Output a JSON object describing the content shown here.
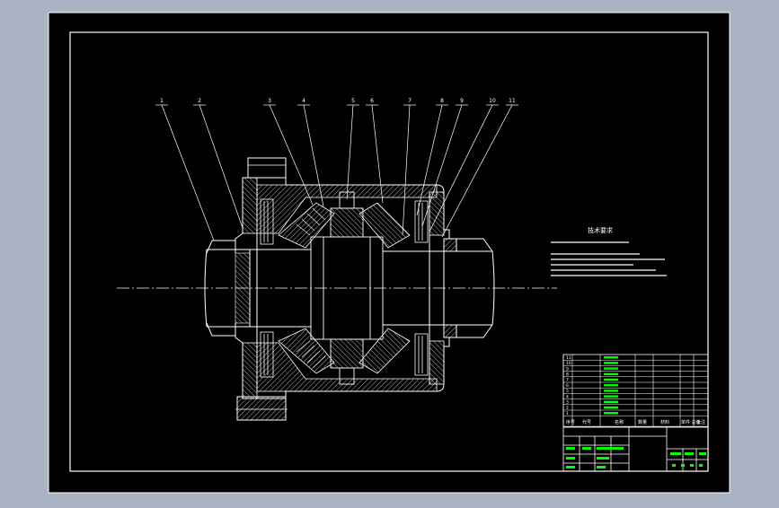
{
  "colors": {
    "background": "#a9b3c4",
    "paper": "#000000",
    "line": "#ffffff",
    "hatch": "#ffffff",
    "title_text": "#00ff00",
    "table_line": "#ffffff"
  },
  "callouts": [
    "1",
    "2",
    "3",
    "4",
    "5",
    "6",
    "7",
    "8",
    "9",
    "10",
    "11"
  ],
  "notes": {
    "title": "技术要求"
  },
  "bom": {
    "row_numbers": [
      "11",
      "10",
      "9",
      "8",
      "7",
      "6",
      "5",
      "4",
      "3",
      "2",
      "1"
    ],
    "header": {
      "seq": "序号",
      "code": "代号",
      "name": "名称",
      "qty": "数量",
      "material": "材料",
      "weight": "单件 总计",
      "remark": "备注"
    }
  }
}
